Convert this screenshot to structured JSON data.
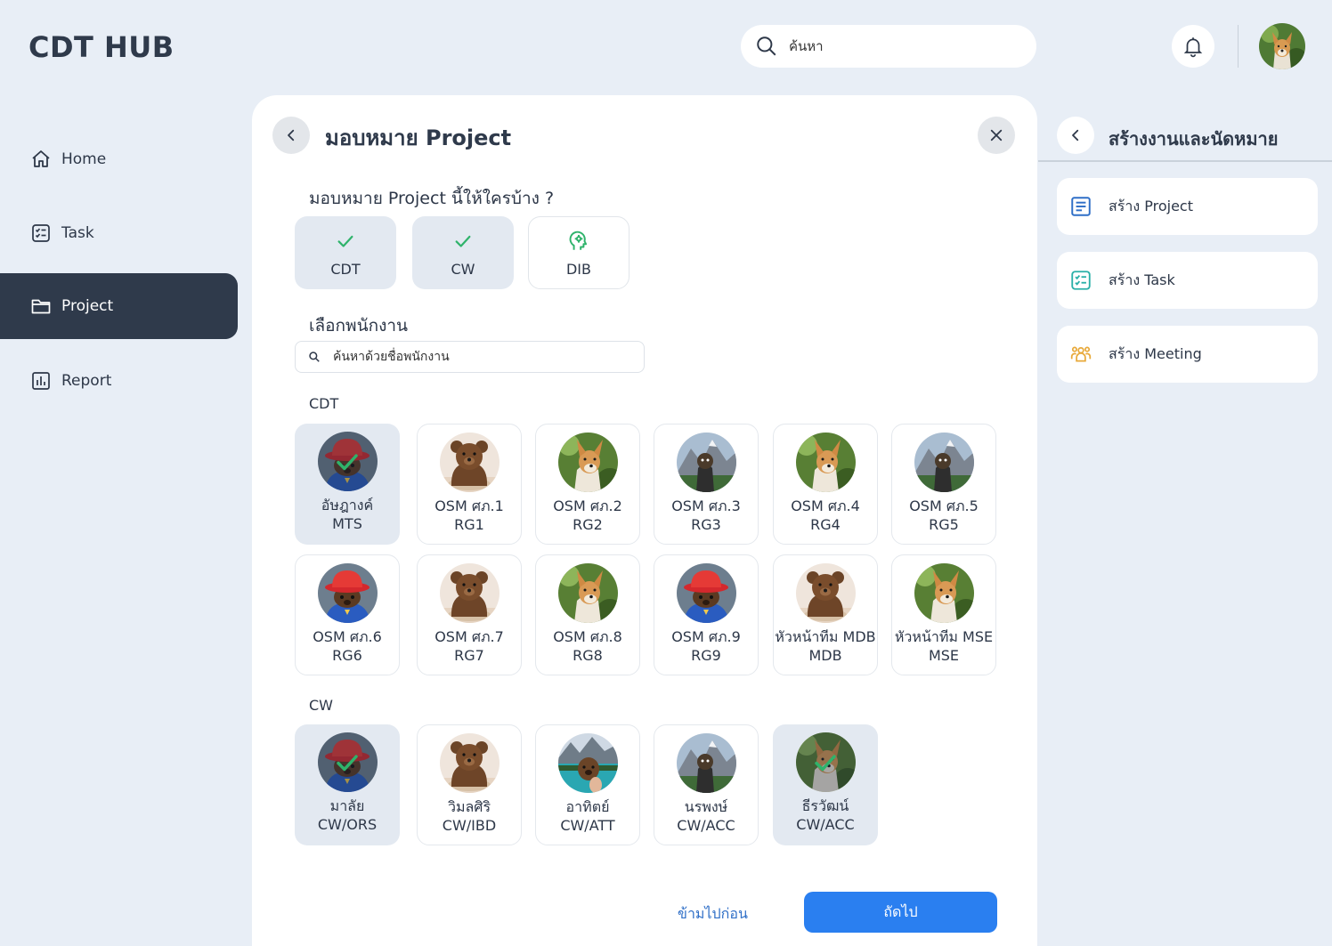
{
  "app": {
    "title": "CDT HUB"
  },
  "search": {
    "placeholder": "ค้นหา"
  },
  "sidebar": {
    "items": [
      {
        "label": "Home",
        "icon": "home-icon"
      },
      {
        "label": "Task",
        "icon": "task-icon"
      },
      {
        "label": "Project",
        "icon": "folder-icon",
        "active": true
      },
      {
        "label": "Report",
        "icon": "report-icon"
      }
    ]
  },
  "modal": {
    "title": "มอบหมาย Project",
    "question": "มอบหมาย Project นี้ให้ใครบ้าง ?",
    "orgs": [
      {
        "label": "CDT",
        "selected": true,
        "icon": "check-icon"
      },
      {
        "label": "CW",
        "selected": true,
        "icon": "check-icon"
      },
      {
        "label": "DIB",
        "selected": false,
        "icon": "brain-icon"
      }
    ],
    "choose_label": "เลือกพนักงาน",
    "employee_search_placeholder": "ค้นหาด้วยชื่อพนักงาน",
    "groups": [
      {
        "label": "CDT",
        "members": [
          {
            "name": "อัษฎางค์",
            "role": "MTS",
            "selected": true,
            "avatar": "hat"
          },
          {
            "name": "OSM ศภ.1",
            "role": "RG1",
            "selected": false,
            "avatar": "bear"
          },
          {
            "name": "OSM ศภ.2",
            "role": "RG2",
            "selected": false,
            "avatar": "dog"
          },
          {
            "name": "OSM ศภ.3",
            "role": "RG3",
            "selected": false,
            "avatar": "mountain"
          },
          {
            "name": "OSM ศภ.4",
            "role": "RG4",
            "selected": false,
            "avatar": "dog"
          },
          {
            "name": "OSM ศภ.5",
            "role": "RG5",
            "selected": false,
            "avatar": "mountain"
          },
          {
            "name": "OSM ศภ.6",
            "role": "RG6",
            "selected": false,
            "avatar": "hat"
          },
          {
            "name": "OSM ศภ.7",
            "role": "RG7",
            "selected": false,
            "avatar": "bear"
          },
          {
            "name": "OSM ศภ.8",
            "role": "RG8",
            "selected": false,
            "avatar": "dog"
          },
          {
            "name": "OSM ศภ.9",
            "role": "RG9",
            "selected": false,
            "avatar": "hat"
          },
          {
            "name": "หัวหน้าทีม MDB",
            "role": "MDB",
            "selected": false,
            "avatar": "bear"
          },
          {
            "name": "หัวหน้าทีม MSE",
            "role": "MSE",
            "selected": false,
            "avatar": "dog"
          }
        ]
      },
      {
        "label": "CW",
        "members": [
          {
            "name": "มาลัย",
            "role": "CW/ORS",
            "selected": true,
            "avatar": "hat"
          },
          {
            "name": "วิมลศิริ",
            "role": "CW/IBD",
            "selected": false,
            "avatar": "bear"
          },
          {
            "name": "อาทิตย์",
            "role": "CW/ATT",
            "selected": false,
            "avatar": "lake"
          },
          {
            "name": "นรพงษ์",
            "role": "CW/ACC",
            "selected": false,
            "avatar": "mountain"
          },
          {
            "name": "ธีรวัฒน์",
            "role": "CW/ACC",
            "selected": true,
            "avatar": "dog"
          }
        ]
      }
    ],
    "skip_label": "ข้ามไปก่อน",
    "next_label": "ถัดไป"
  },
  "right_panel": {
    "title": "สร้างงานและนัดหมาย",
    "items": [
      {
        "label": "สร้าง Project",
        "icon": "document-icon"
      },
      {
        "label": "สร้าง Task",
        "icon": "task-icon"
      },
      {
        "label": "สร้าง Meeting",
        "icon": "people-icon"
      }
    ]
  },
  "colors": {
    "background": "#e8eef6",
    "sidebar_active": "#2f3a4b",
    "primary_button": "#2a7ff0",
    "check_green": "#2fb36b",
    "selected_card": "#e3e9f1"
  }
}
